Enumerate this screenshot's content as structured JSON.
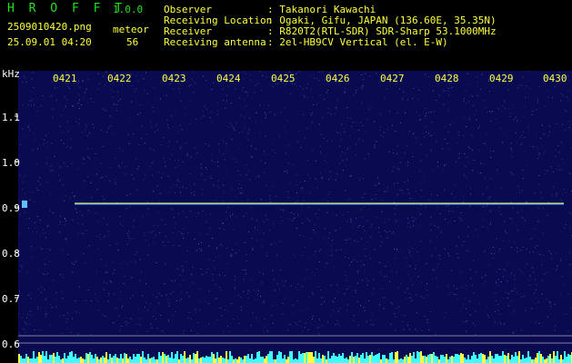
{
  "app": {
    "name": "H R O F F T",
    "version": "1.0.0"
  },
  "file": {
    "name": "2509010420.png",
    "datetime": "25.09.01 04:20"
  },
  "meteor": {
    "label": "meteor",
    "count": "56"
  },
  "info": {
    "labels": [
      "Observer",
      "Receiving Location",
      "Receiver",
      "Receiving antenna"
    ],
    "values": [
      ": Takanori Kawachi",
      ": Ogaki, Gifu, JAPAN (136.60E, 35.35N)",
      ": R820T2(RTL-SDR) SDR-Sharp 53.1000MHz",
      ": 2el-HB9CV Vertical (el. E-W)"
    ]
  },
  "axis": {
    "unit": "kHz",
    "time_ticks": [
      "0421",
      "0422",
      "0423",
      "0424",
      "0425",
      "0426",
      "0427",
      "0428",
      "0429",
      "0430"
    ],
    "freq_ticks": [
      "1.1",
      "1.0",
      "0.9",
      "0.8",
      "0.7",
      "0.6"
    ]
  },
  "colors": {
    "bg": "#0a0a50",
    "trace": "#ffff60",
    "signal": "#40a0ff",
    "bars": "#40ffff"
  }
}
